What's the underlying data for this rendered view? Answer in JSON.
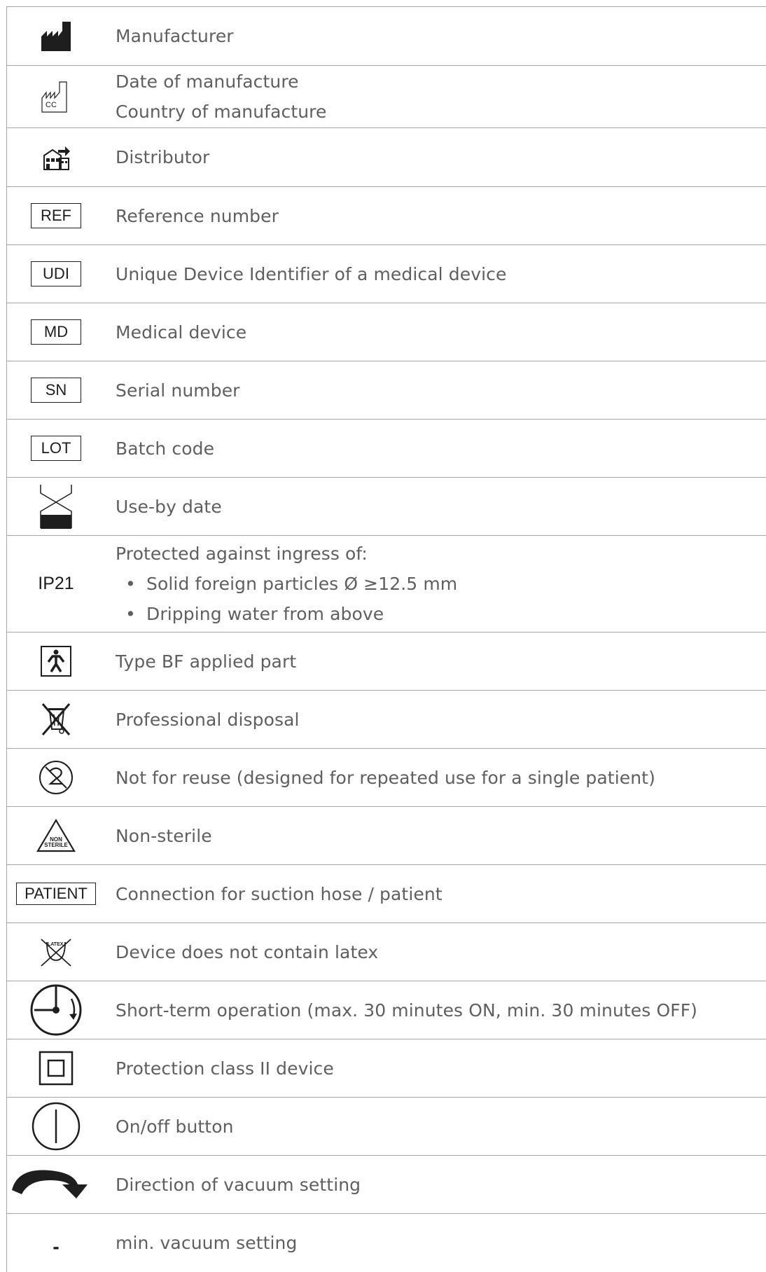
{
  "rows": [
    {
      "symbol": "factory-icon",
      "lines": [
        "Manufacturer"
      ]
    },
    {
      "symbol": "date-of-manufacture-icon",
      "symbol_text": "CC",
      "lines": [
        "Date of manufacture",
        "Country of manufacture"
      ]
    },
    {
      "symbol": "distributor-icon",
      "lines": [
        "Distributor"
      ]
    },
    {
      "symbol": "ref-box",
      "symbol_text": "REF",
      "lines": [
        "Reference number"
      ]
    },
    {
      "symbol": "udi-box",
      "symbol_text": "UDI",
      "lines": [
        "Unique Device Identifier of a medical device"
      ]
    },
    {
      "symbol": "md-box",
      "symbol_text": "MD",
      "lines": [
        "Medical device"
      ]
    },
    {
      "symbol": "sn-box",
      "symbol_text": "SN",
      "lines": [
        "Serial number"
      ]
    },
    {
      "symbol": "lot-box",
      "symbol_text": "LOT",
      "lines": [
        "Batch code"
      ]
    },
    {
      "symbol": "hourglass-icon",
      "lines": [
        "Use-by date"
      ]
    },
    {
      "symbol": "ip-rating-text",
      "symbol_text": "IP21",
      "lines": [
        "Protected against ingress of:"
      ],
      "bullets": [
        "Solid foreign particles Ø ≥12.5 mm",
        "Dripping water from above"
      ]
    },
    {
      "symbol": "type-bf-icon",
      "lines": [
        "Type BF applied part"
      ]
    },
    {
      "symbol": "crossed-bin-icon",
      "lines": [
        "Professional disposal"
      ]
    },
    {
      "symbol": "no-reuse-icon",
      "lines": [
        "Not for reuse (designed for repeated use for a single patient)"
      ]
    },
    {
      "symbol": "non-sterile-icon",
      "symbol_text": "NON STERILE",
      "lines": [
        "Non-sterile"
      ]
    },
    {
      "symbol": "patient-box",
      "symbol_text": "PATIENT",
      "lines": [
        "Connection for suction hose / patient"
      ]
    },
    {
      "symbol": "latex-free-icon",
      "symbol_text": "LATEX",
      "lines": [
        "Device does not contain latex"
      ]
    },
    {
      "symbol": "short-term-operation-icon",
      "lines": [
        "Short-term operation (max. 30 minutes ON, min. 30 minutes OFF)"
      ]
    },
    {
      "symbol": "class-ii-icon",
      "lines": [
        "Protection class II device"
      ]
    },
    {
      "symbol": "power-icon",
      "lines": [
        "On/off button"
      ]
    },
    {
      "symbol": "curved-arrow-icon",
      "lines": [
        "Direction of vacuum setting"
      ]
    },
    {
      "symbol": "minus-icon",
      "symbol_text": "-",
      "lines": [
        "min. vacuum setting"
      ]
    }
  ],
  "colors": {
    "text": "#5f5f5f",
    "symbol": "#1e1e1e",
    "rule": "#a6a6a6"
  }
}
